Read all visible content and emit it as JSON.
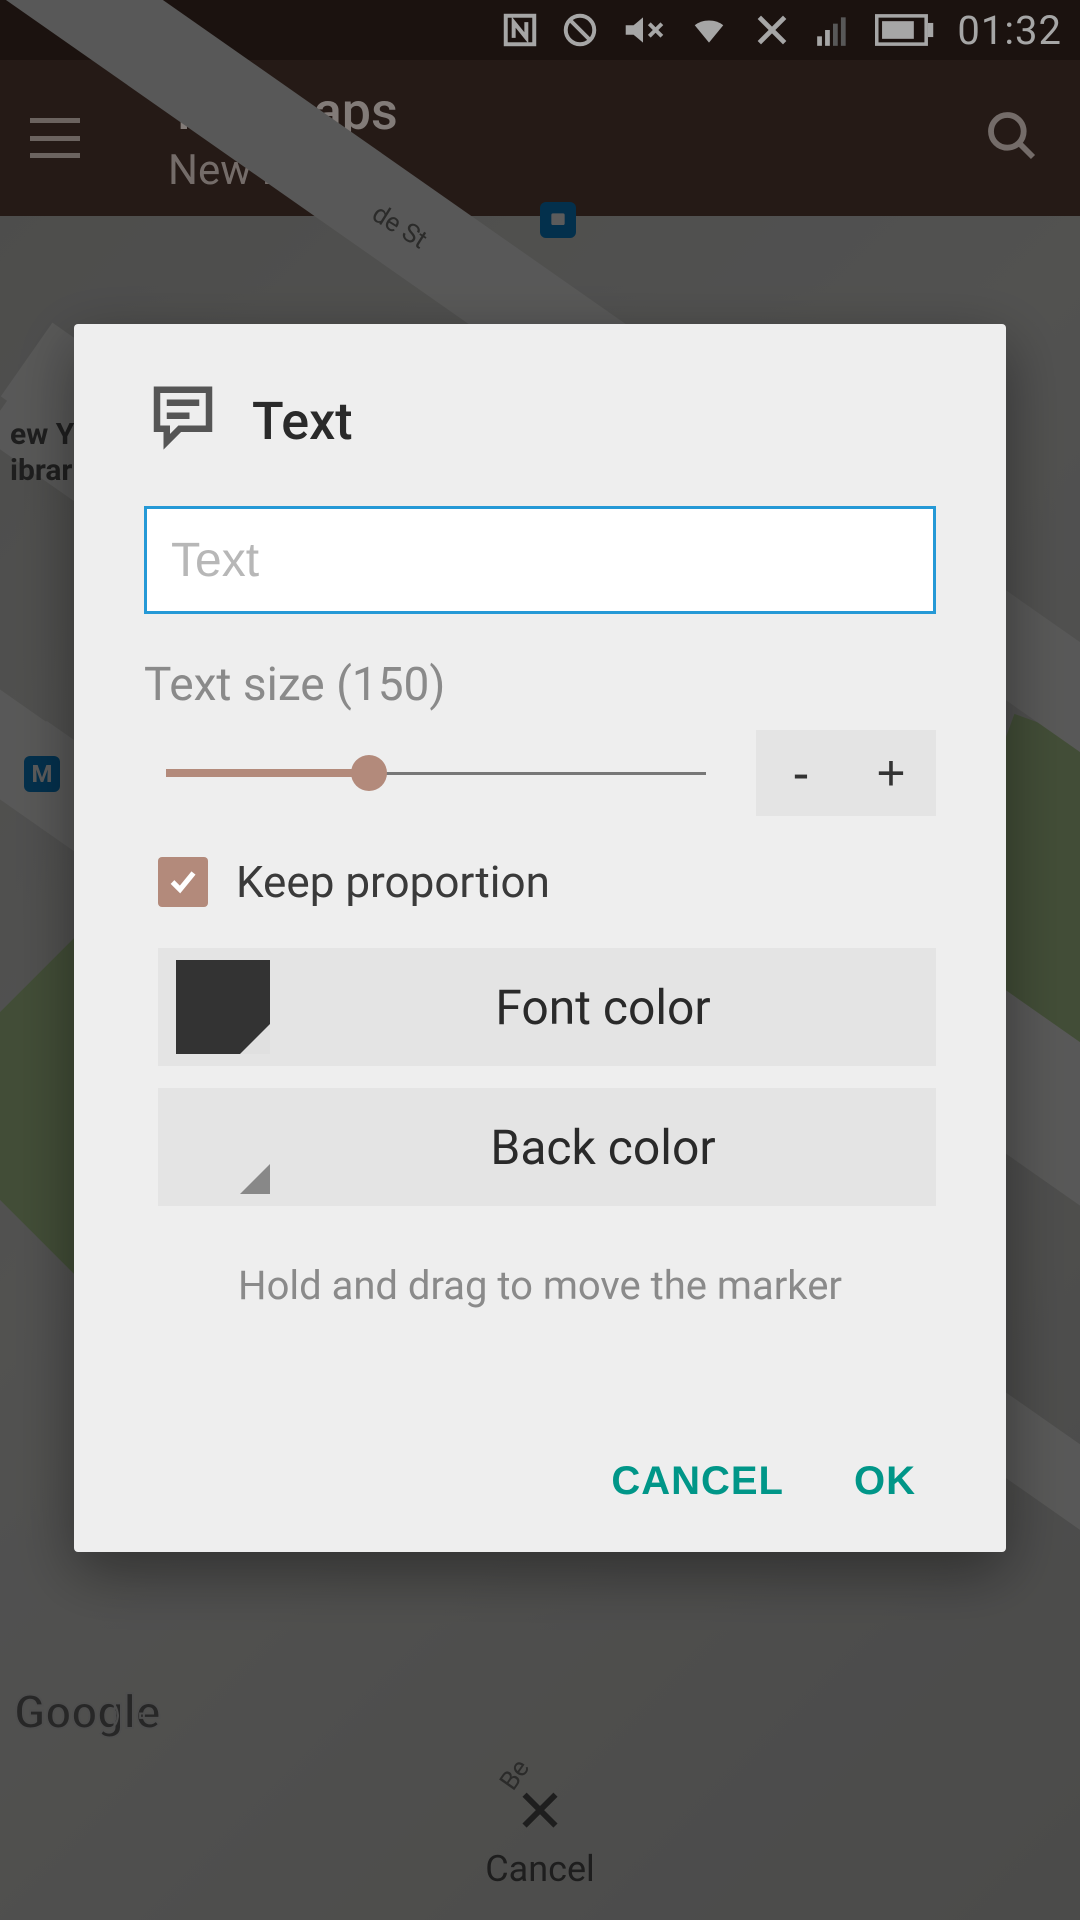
{
  "statusbar": {
    "time": "01:32",
    "icons": [
      "nfc",
      "do-not-disturb",
      "volume-muted",
      "wifi",
      "mobile-data-off",
      "signal",
      "battery"
    ]
  },
  "appbar": {
    "title": "Toolmaps",
    "subtitle": "New map"
  },
  "map": {
    "logo": "Google",
    "cancel_label": "Cancel",
    "partial_label_1": "ew Y",
    "partial_label_2": "ibrar",
    "street_fragment_1": "de St",
    "street_fragment_2": "Be",
    "pin_m": "M"
  },
  "dialog": {
    "title": "Text",
    "input_placeholder": "Text",
    "input_value": "",
    "size_label_prefix": "Text size",
    "size_value": 150,
    "size_min": 0,
    "size_max": 400,
    "stepper_minus": "-",
    "stepper_plus": "+",
    "keep_proportion_label": "Keep proportion",
    "keep_proportion_checked": true,
    "font_color_label": "Font color",
    "font_color_value": "#333333",
    "back_color_label": "Back color",
    "back_color_value": "transparent",
    "hint": "Hold and drag to move the marker",
    "cancel": "CANCEL",
    "ok": "OK"
  }
}
